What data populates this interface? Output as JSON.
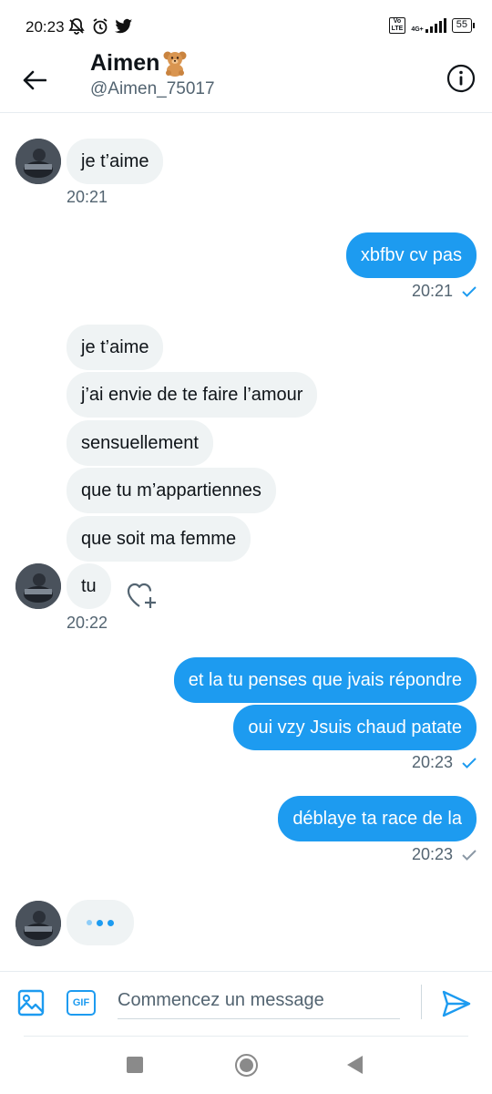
{
  "status_bar": {
    "time": "20:23",
    "volte_top": "Vo",
    "volte_bottom": "LTE",
    "network": "4G+",
    "battery": "55",
    "icons": [
      "mute-bell-icon",
      "alarm-icon",
      "twitter-bird-icon"
    ]
  },
  "header": {
    "name": "Aimen",
    "emoji": "teddy-bear-icon",
    "handle": "@Aimen_75017"
  },
  "messages": [
    {
      "side": "in",
      "text": "je t’aime"
    },
    {
      "side": "in_time",
      "text": "20:21"
    },
    {
      "side": "out",
      "text": "xbfbv cv pas"
    },
    {
      "side": "out_time",
      "text": "20:21"
    },
    {
      "side": "in",
      "text": "je t’aime"
    },
    {
      "side": "in",
      "text": "j’ai envie de te faire l’amour"
    },
    {
      "side": "in",
      "text": "sensuellement"
    },
    {
      "side": "in",
      "text": "que tu m’appartiennes"
    },
    {
      "side": "in",
      "text": "que soit ma femme"
    },
    {
      "side": "in",
      "text": "tu"
    },
    {
      "side": "in_time",
      "text": "20:22"
    },
    {
      "side": "out",
      "text": "et la tu penses que jvais répondre"
    },
    {
      "side": "out",
      "text": "oui vzy Jsuis chaud patate"
    },
    {
      "side": "out_time",
      "text": "20:23"
    },
    {
      "side": "out",
      "text": "déblaye ta race de la"
    },
    {
      "side": "out_time",
      "text": "20:23"
    }
  ],
  "composer": {
    "placeholder": "Commencez un message",
    "gif_label": "GIF"
  },
  "colors": {
    "accent": "#1d9bf0",
    "incoming_bubble": "#eff3f4",
    "secondary_text": "#536471"
  }
}
